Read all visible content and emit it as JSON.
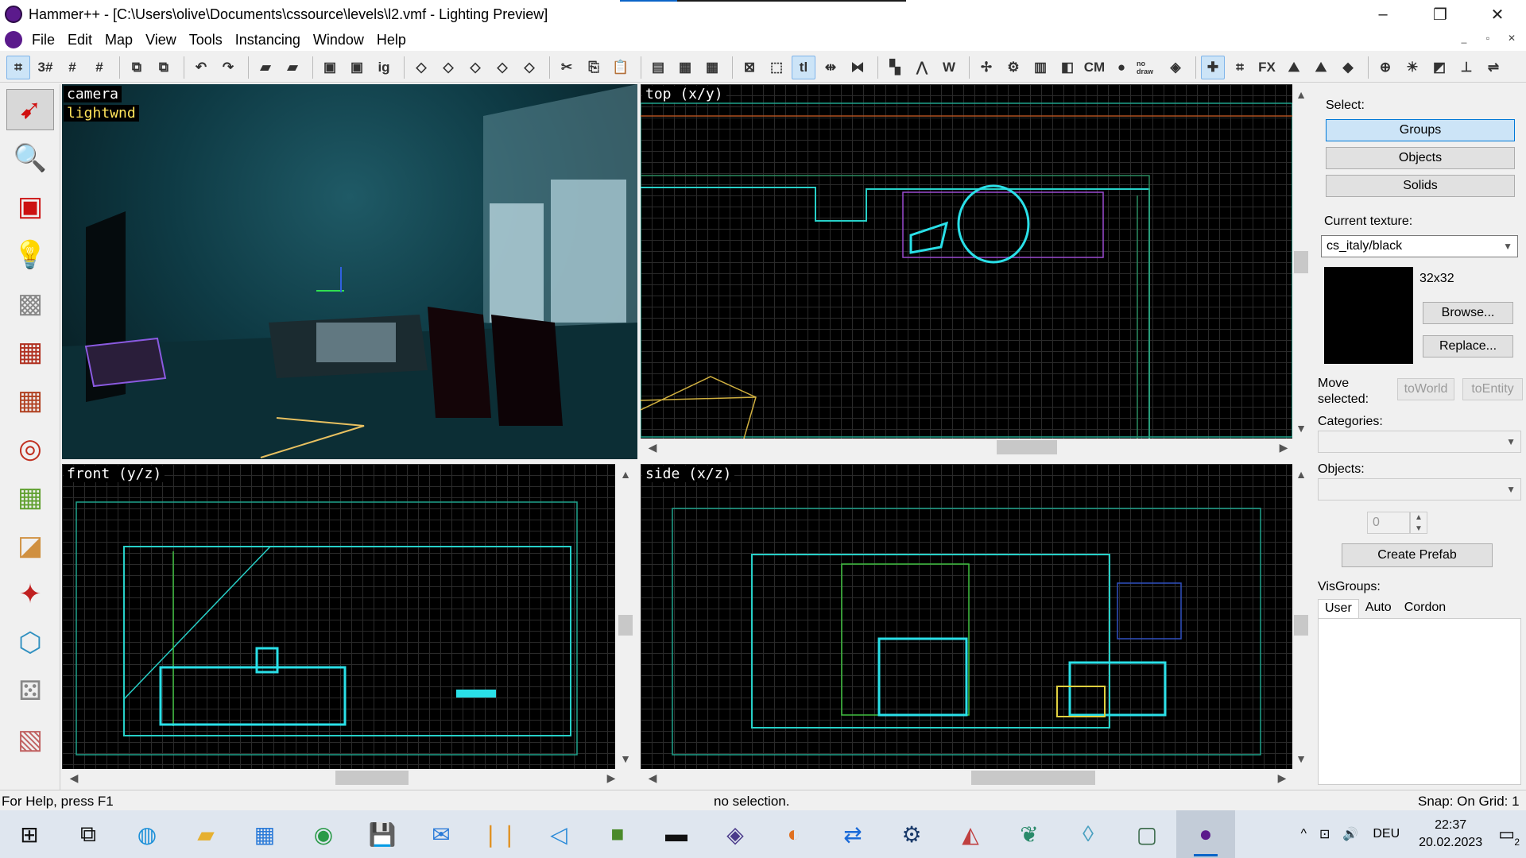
{
  "window": {
    "title": "Hammer++ - [C:\\Users\\olive\\Documents\\cssource\\levels\\l2.vmf - Lighting Preview]"
  },
  "window_controls": {
    "minimize": "–",
    "maximize": "❐",
    "close": "✕"
  },
  "menu": [
    "File",
    "Edit",
    "Map",
    "View",
    "Tools",
    "Instancing",
    "Window",
    "Help"
  ],
  "mdi_controls": {
    "minimize": "_",
    "restore": "▫",
    "close": "✕"
  },
  "toolbar_items": [
    {
      "name": "grid-toggle",
      "glyph": "⌗",
      "active": true
    },
    {
      "name": "grid-3d",
      "glyph": "3#"
    },
    {
      "name": "grid-smaller",
      "glyph": "#"
    },
    {
      "name": "grid-larger",
      "glyph": "#"
    },
    {
      "sep": true
    },
    {
      "name": "group",
      "glyph": "⧉"
    },
    {
      "name": "ungroup",
      "glyph": "⧉"
    },
    {
      "sep": true
    },
    {
      "name": "undo",
      "glyph": "↶"
    },
    {
      "name": "redo",
      "glyph": "↷"
    },
    {
      "sep": true
    },
    {
      "name": "carve",
      "glyph": "▰"
    },
    {
      "name": "hollow",
      "glyph": "▰"
    },
    {
      "sep": true
    },
    {
      "name": "hide",
      "glyph": "▣"
    },
    {
      "name": "show",
      "glyph": "▣"
    },
    {
      "name": "ig",
      "glyph": "ig"
    },
    {
      "sep": true
    },
    {
      "name": "flip-x",
      "glyph": "◇"
    },
    {
      "name": "flip-y",
      "glyph": "◇"
    },
    {
      "name": "flip-z",
      "glyph": "◇"
    },
    {
      "name": "rotate",
      "glyph": "◇"
    },
    {
      "name": "scale",
      "glyph": "◇"
    },
    {
      "sep": true
    },
    {
      "name": "cut",
      "glyph": "✂"
    },
    {
      "name": "copy",
      "glyph": "⎘"
    },
    {
      "name": "paste",
      "glyph": "📋"
    },
    {
      "sep": true
    },
    {
      "name": "toggle-a",
      "glyph": "▤"
    },
    {
      "name": "toggle-b",
      "glyph": "▦"
    },
    {
      "name": "toggle-c",
      "glyph": "▦"
    },
    {
      "sep": true
    },
    {
      "name": "select-box",
      "glyph": "⊠"
    },
    {
      "name": "select-dashed",
      "glyph": "⬚"
    },
    {
      "name": "texture-lock",
      "glyph": "tl",
      "active": true
    },
    {
      "name": "move-arrows",
      "glyph": "⇹"
    },
    {
      "name": "clip",
      "glyph": "⧓"
    },
    {
      "sep": true
    },
    {
      "name": "vis-a",
      "glyph": "▚"
    },
    {
      "name": "vis-b",
      "glyph": "⋀"
    },
    {
      "name": "vis-c",
      "glyph": "W"
    },
    {
      "sep": true
    },
    {
      "name": "tool-a",
      "glyph": "✢"
    },
    {
      "name": "tool-b",
      "glyph": "⚙"
    },
    {
      "name": "tool-c",
      "glyph": "▥"
    },
    {
      "name": "tool-d",
      "glyph": "◧"
    },
    {
      "name": "cm",
      "glyph": "CM"
    },
    {
      "name": "tool-e",
      "glyph": "●"
    },
    {
      "name": "nodraw",
      "glyph": "no draw"
    },
    {
      "name": "tool-f",
      "glyph": "◈"
    },
    {
      "sep": true
    },
    {
      "name": "tool-g",
      "glyph": "✚",
      "active": true
    },
    {
      "name": "tool-h",
      "glyph": "⌗"
    },
    {
      "name": "fx",
      "glyph": "FX"
    },
    {
      "name": "tool-i",
      "glyph": "⛰"
    },
    {
      "name": "tool-j",
      "glyph": "⛰"
    },
    {
      "name": "tool-k",
      "glyph": "◆"
    },
    {
      "sep": true
    },
    {
      "name": "tool-l",
      "glyph": "⊕"
    },
    {
      "name": "tool-m",
      "glyph": "☀"
    },
    {
      "name": "tool-n",
      "glyph": "◩"
    },
    {
      "name": "tool-o",
      "glyph": "⊥"
    },
    {
      "name": "tool-p",
      "glyph": "⇌"
    }
  ],
  "left_tools": [
    {
      "name": "selection-tool",
      "glyph": "➹",
      "color": "#d01010",
      "active": true
    },
    {
      "name": "magnify-tool",
      "glyph": "🔍",
      "color": "#d01010"
    },
    {
      "name": "camera-tool",
      "glyph": "▣",
      "color": "#cc1010"
    },
    {
      "name": "entity-tool",
      "glyph": "💡",
      "color": "#888"
    },
    {
      "name": "block-tool",
      "glyph": "▩",
      "color": "#888"
    },
    {
      "name": "texture-tool",
      "glyph": "▦",
      "color": "#b03020"
    },
    {
      "name": "apply-texture-tool",
      "glyph": "▦",
      "color": "#b04020"
    },
    {
      "name": "decal-tool",
      "glyph": "◎",
      "color": "#c03020"
    },
    {
      "name": "overlay-tool",
      "glyph": "▦",
      "color": "#60a030"
    },
    {
      "name": "clipping-tool",
      "glyph": "◪",
      "color": "#d09040"
    },
    {
      "name": "vertex-tool",
      "glyph": "✦",
      "color": "#c02020"
    },
    {
      "name": "path-tool",
      "glyph": "⬡",
      "color": "#3090c0"
    },
    {
      "name": "cordon-tool",
      "glyph": "⚄",
      "color": "#888"
    },
    {
      "name": "sculpt-tool",
      "glyph": "▧",
      "color": "#c06060"
    }
  ],
  "viewports": {
    "camera": {
      "label": "camera",
      "sublabel": "lightwnd"
    },
    "top": {
      "label": "top (x/y)"
    },
    "front": {
      "label": "front (y/z)"
    },
    "side": {
      "label": "side (x/z)"
    }
  },
  "right_panel": {
    "select_label": "Select:",
    "groups_btn": "Groups",
    "objects_btn": "Objects",
    "solids_btn": "Solids",
    "current_texture_label": "Current texture:",
    "current_texture_value": "cs_italy/black",
    "texture_size": "32x32",
    "browse_btn": "Browse...",
    "replace_btn": "Replace...",
    "move_selected_label1": "Move",
    "move_selected_label2": "selected:",
    "to_world_btn": "toWorld",
    "to_entity_btn": "toEntity",
    "categories_label": "Categories:",
    "objects_label": "Objects:",
    "count_value": "0",
    "create_prefab_btn": "Create Prefab",
    "visgroups_label": "VisGroups:",
    "visgroup_tabs": [
      "User",
      "Auto",
      "Cordon"
    ]
  },
  "status": {
    "help": "For Help, press F1",
    "selection": "no selection.",
    "snap": "Snap: On Grid: 1"
  },
  "taskbar": {
    "apps": [
      {
        "name": "start-button",
        "glyph": "⊞",
        "color": "#111"
      },
      {
        "name": "task-view",
        "glyph": "⧉",
        "color": "#111"
      },
      {
        "name": "edge",
        "glyph": "◍",
        "color": "#1a8fd8"
      },
      {
        "name": "file-explorer",
        "glyph": "▰",
        "color": "#e6b030"
      },
      {
        "name": "microsoft-store",
        "glyph": "▦",
        "color": "#2a7ad8"
      },
      {
        "name": "chrome",
        "glyph": "◉",
        "color": "#2a9a48"
      },
      {
        "name": "save-app",
        "glyph": "💾",
        "color": "#2a5ad8"
      },
      {
        "name": "mail",
        "glyph": "✉",
        "color": "#2a7ad8"
      },
      {
        "name": "app-orange",
        "glyph": "❘❘",
        "color": "#e09020"
      },
      {
        "name": "vscode",
        "glyph": "◁",
        "color": "#2a8ad8"
      },
      {
        "name": "minecraft",
        "glyph": "■",
        "color": "#4a8a2a"
      },
      {
        "name": "terminal",
        "glyph": "▬",
        "color": "#111"
      },
      {
        "name": "app-ball",
        "glyph": "◈",
        "color": "#4a3a8a"
      },
      {
        "name": "blender",
        "glyph": "◐",
        "color": "#e07020"
      },
      {
        "name": "teamviewer",
        "glyph": "⇄",
        "color": "#1a6ad8"
      },
      {
        "name": "steam",
        "glyph": "⚙",
        "color": "#1a3a6a"
      },
      {
        "name": "app-anime",
        "glyph": "◭",
        "color": "#c04040"
      },
      {
        "name": "app-tree",
        "glyph": "❦",
        "color": "#2a8a6a"
      },
      {
        "name": "app-glass",
        "glyph": "◊",
        "color": "#4aa0c0"
      },
      {
        "name": "app-window",
        "glyph": "▢",
        "color": "#3a6a4a"
      },
      {
        "name": "hammer-active",
        "glyph": "●",
        "color": "#5b1a8c",
        "active": true
      }
    ],
    "tray_chevron": "^",
    "tray_network": "⊡",
    "tray_volume": "🔊",
    "language": "DEU",
    "time": "22:37",
    "date": "20.02.2023",
    "notification_count": "2"
  }
}
